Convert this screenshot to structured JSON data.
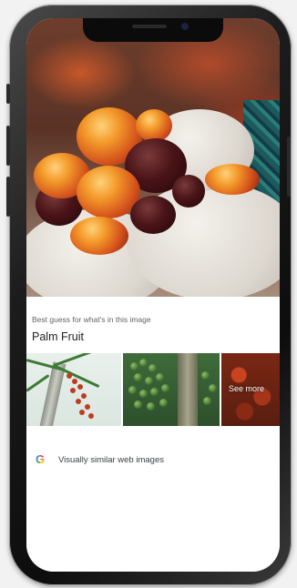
{
  "result": {
    "caption": "Best guess for what's in this image",
    "title": "Palm Fruit"
  },
  "thumbnails": {
    "see_more_label": "See more"
  },
  "similar": {
    "icon": "google-g-icon",
    "label": "Visually similar web images"
  },
  "colors": {
    "accent_blue": "#4285f4",
    "accent_red": "#ea4335",
    "accent_yellow": "#fbbc05",
    "accent_green": "#34a853"
  }
}
